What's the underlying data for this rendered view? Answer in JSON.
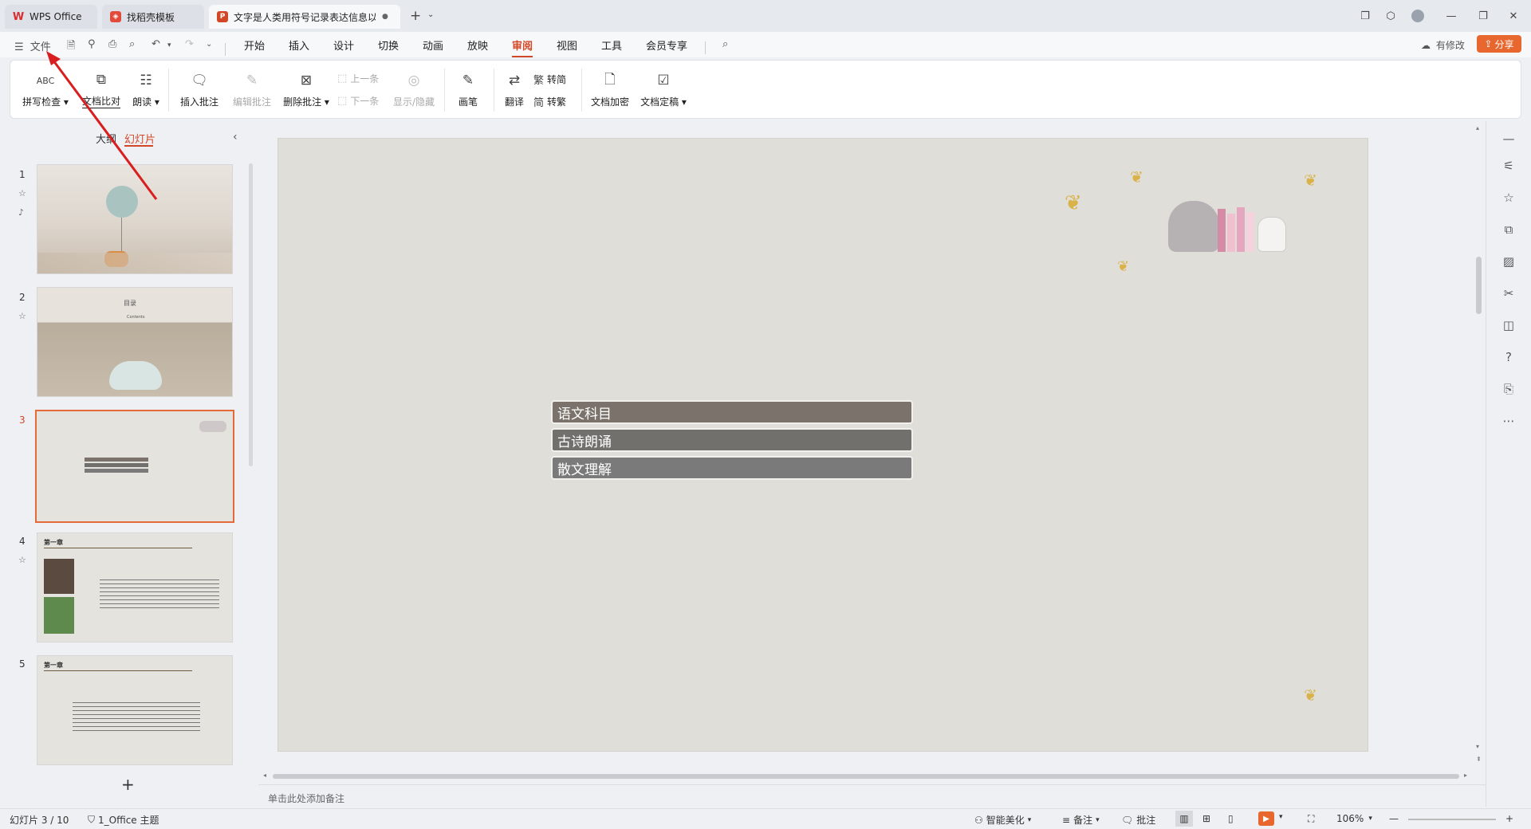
{
  "tabs": [
    {
      "label": "WPS Office"
    },
    {
      "label": "找稻壳模板"
    },
    {
      "label": "文字是人类用符号记录表达信息以"
    }
  ],
  "menu": {
    "file": "文件",
    "items": [
      "开始",
      "插入",
      "设计",
      "切换",
      "动画",
      "放映",
      "审阅",
      "视图",
      "工具",
      "会员专享"
    ],
    "active": "审阅",
    "modified": "有修改",
    "share": "分享"
  },
  "ribbon": {
    "spellcheck": "拼写检查",
    "doc_compare": "文档比对",
    "read_aloud": "朗读",
    "insert_comment": "插入批注",
    "edit_comment": "编辑批注",
    "delete_comment": "删除批注",
    "prev": "上一条",
    "next": "下一条",
    "show_hide": "显示/隐藏",
    "pen": "画笔",
    "translate": "翻译",
    "to_simplified": "转简",
    "to_traditional": "转繁",
    "encrypt": "文档加密",
    "finalize": "文档定稿",
    "abc": "ABC",
    "trad_char": "繁",
    "simp_char": "简"
  },
  "panel": {
    "outline": "大纲",
    "slides": "幻灯片",
    "numbers": [
      "1",
      "2",
      "3",
      "4",
      "5"
    ],
    "thumb2_title": "目录",
    "thumb2_sub": "Contents",
    "thumb45_heading": "第一章"
  },
  "slide": {
    "items": [
      "语文科目",
      "古诗朗诵",
      "散文理解"
    ]
  },
  "notes": {
    "placeholder": "单击此处添加备注"
  },
  "status": {
    "slide_info": "幻灯片 3 / 10",
    "theme": "1_Office 主题",
    "beautify": "智能美化",
    "notes": "备注",
    "comments": "批注",
    "zoom": "106%"
  },
  "colors": {
    "accent": "#d24726",
    "bar1": "#7a726b",
    "bar2": "#72706d",
    "bar3": "#7a7a7a"
  }
}
